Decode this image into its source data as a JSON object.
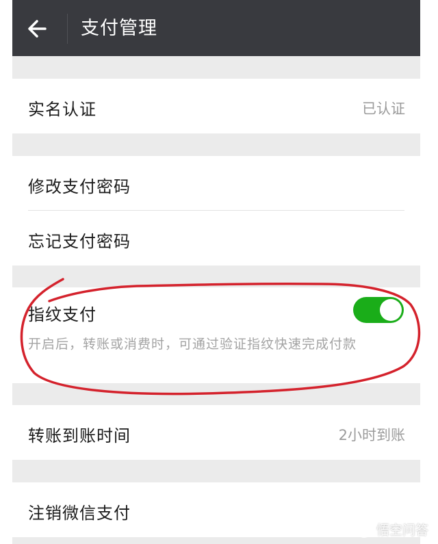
{
  "header": {
    "title": "支付管理",
    "back_icon": "arrow-left-icon"
  },
  "groups": {
    "realname": {
      "label": "实名认证",
      "value": "已认证"
    },
    "password": {
      "change_label": "修改支付密码",
      "forgot_label": "忘记支付密码"
    },
    "fingerprint": {
      "label": "指纹支付",
      "enabled": true,
      "description": "开启后，转账或消费时，可通过验证指纹快速完成付款"
    },
    "transfer": {
      "label": "转账到账时间",
      "value": "2小时到账"
    },
    "cancel": {
      "label": "注销微信支付"
    }
  },
  "watermark": {
    "text": "悟空问答",
    "icon": "wukong-logo-icon"
  },
  "colors": {
    "titlebar": "#393a3f",
    "background": "#ebebeb",
    "toggle_on": "#1aad19",
    "annotation": "#d4222c"
  }
}
